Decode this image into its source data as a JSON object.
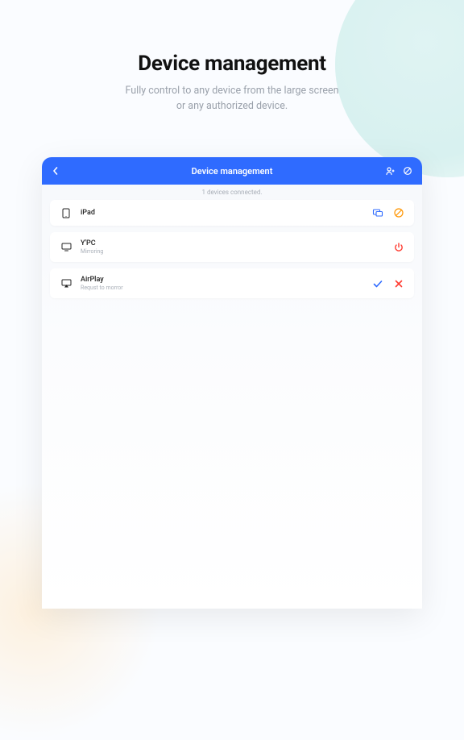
{
  "hero": {
    "title": "Device management",
    "subtitle_line1": "Fully control to any device from the large screen",
    "subtitle_line2": "or any authorized device."
  },
  "panel": {
    "header_title": "Device management",
    "status_text": "1 devices connected."
  },
  "devices": [
    {
      "name": "iPad",
      "sub": ""
    },
    {
      "name": "Y'PC",
      "sub": "Mirroring"
    },
    {
      "name": "AirPlay",
      "sub": "Requst to morror"
    }
  ],
  "colors": {
    "accent": "#2f6bff",
    "danger": "#ff3b30",
    "power": "#ff3b30",
    "amber": "#ff9500"
  }
}
